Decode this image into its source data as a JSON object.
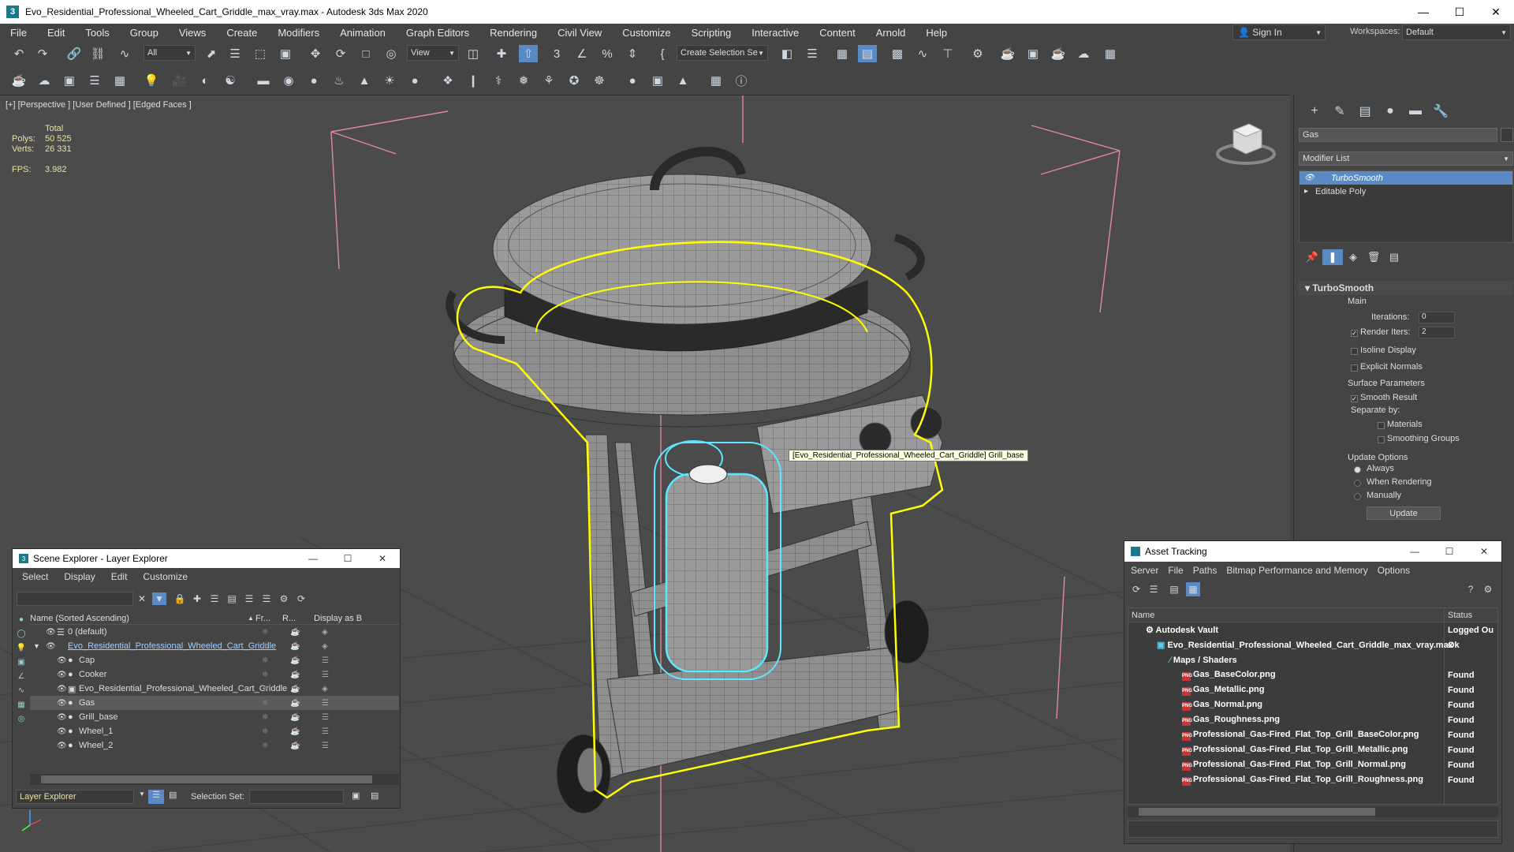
{
  "app": {
    "title": "Evo_Residential_Professional_Wheeled_Cart_Griddle_max_vray.max - Autodesk 3ds Max 2020",
    "icon_letter": "3"
  },
  "menu": [
    "File",
    "Edit",
    "Tools",
    "Group",
    "Views",
    "Create",
    "Modifiers",
    "Animation",
    "Graph Editors",
    "Rendering",
    "Civil View",
    "Customize",
    "Scripting",
    "Interactive",
    "Content",
    "Arnold",
    "Help"
  ],
  "signin": "Sign In",
  "workspaces": {
    "label": "Workspaces:",
    "value": "Default"
  },
  "toolbar": {
    "selection_filter": "All",
    "ref_coord": "View",
    "named_selection": "Create Selection Se"
  },
  "viewport": {
    "label": "[+] [Perspective ] [User Defined ] [Edged Faces ]",
    "stats": {
      "header": "Total",
      "polys_label": "Polys:",
      "polys": "50 525",
      "verts_label": "Verts:",
      "verts": "26 331",
      "fps_label": "FPS:",
      "fps": "3.982"
    },
    "tooltip": "[Evo_Residential_Professional_Wheeled_Cart_Griddle] Grill_base"
  },
  "command_panel": {
    "object_name": "Gas",
    "modifier_list": "Modifier List",
    "stack": [
      "TurboSmooth",
      "Editable Poly"
    ],
    "rollout": {
      "title": "TurboSmooth",
      "main": "Main",
      "iterations_label": "Iterations:",
      "iterations": "0",
      "render_iters_label": "Render Iters:",
      "render_iters": "2",
      "isoline": "Isoline Display",
      "explicit_normals": "Explicit Normals",
      "surface_params": "Surface Parameters",
      "smooth_result": "Smooth Result",
      "separate_by": "Separate by:",
      "materials": "Materials",
      "smoothing_groups": "Smoothing Groups",
      "update_options": "Update Options",
      "always": "Always",
      "when_rendering": "When Rendering",
      "manually": "Manually",
      "update": "Update"
    }
  },
  "scene_explorer": {
    "title": "Scene Explorer - Layer Explorer",
    "menu": [
      "Select",
      "Display",
      "Edit",
      "Customize"
    ],
    "columns": {
      "name": "Name (Sorted Ascending)",
      "frozen": "Fr...",
      "render": "R...",
      "display": "Display as B"
    },
    "rows": [
      {
        "name": "0 (default)",
        "level": 0
      },
      {
        "name": "Evo_Residential_Professional_Wheeled_Cart_Griddle",
        "level": 0
      },
      {
        "name": "Cap",
        "level": 1
      },
      {
        "name": "Cooker",
        "level": 1
      },
      {
        "name": "Evo_Residential_Professional_Wheeled_Cart_Griddle",
        "level": 1
      },
      {
        "name": "Gas",
        "level": 1
      },
      {
        "name": "Grill_base",
        "level": 1
      },
      {
        "name": "Wheel_1",
        "level": 1
      },
      {
        "name": "Wheel_2",
        "level": 1
      }
    ],
    "layer_explorer": "Layer Explorer",
    "selection_set": "Selection Set:"
  },
  "asset_tracking": {
    "title": "Asset Tracking",
    "menu": [
      "Server",
      "File",
      "Paths",
      "Bitmap Performance and Memory",
      "Options"
    ],
    "columns": {
      "name": "Name",
      "status": "Status"
    },
    "rows": [
      {
        "name": "Autodesk Vault",
        "status": "Logged Ou",
        "level": 0
      },
      {
        "name": "Evo_Residential_Professional_Wheeled_Cart_Griddle_max_vray.max",
        "status": "Ok",
        "level": 1
      },
      {
        "name": "Maps / Shaders",
        "status": "",
        "level": 2
      },
      {
        "name": "Gas_BaseColor.png",
        "status": "Found",
        "level": 3
      },
      {
        "name": "Gas_Metallic.png",
        "status": "Found",
        "level": 3
      },
      {
        "name": "Gas_Normal.png",
        "status": "Found",
        "level": 3
      },
      {
        "name": "Gas_Roughness.png",
        "status": "Found",
        "level": 3
      },
      {
        "name": "Professional_Gas-Fired_Flat_Top_Grill_BaseColor.png",
        "status": "Found",
        "level": 3
      },
      {
        "name": "Professional_Gas-Fired_Flat_Top_Grill_Metallic.png",
        "status": "Found",
        "level": 3
      },
      {
        "name": "Professional_Gas-Fired_Flat_Top_Grill_Normal.png",
        "status": "Found",
        "level": 3
      },
      {
        "name": "Professional_Gas-Fired_Flat_Top_Grill_Roughness.png",
        "status": "Found",
        "level": 3
      }
    ]
  },
  "colors": {
    "selection_yellow": "#ffff00",
    "gas_cyan": "#5fe6ff",
    "stack_highlight": "#5a8ac6",
    "stats_yellow": "#e8e4a0"
  }
}
